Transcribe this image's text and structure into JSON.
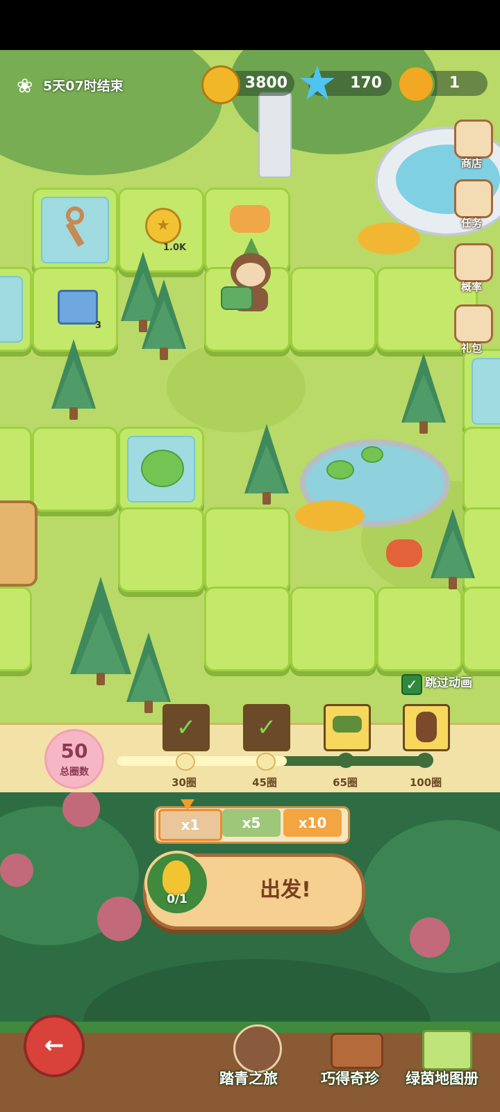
{
  "hud": {
    "timer": "5天07时结束",
    "coins": "3800",
    "gems": "170",
    "honey": "1"
  },
  "side_menu": [
    {
      "label": "商店",
      "icon": "shop-icon"
    },
    {
      "label": "任务",
      "icon": "task-icon"
    },
    {
      "label": "概率",
      "icon": "probability-icon"
    },
    {
      "label": "礼包",
      "icon": "gift-pack-icon"
    }
  ],
  "board": {
    "coin_tile_amount": "1.0K",
    "chest_count": "3",
    "skip_animation_label": "跳过动画",
    "skip_animation_checked": true
  },
  "progress": {
    "total_laps": "50",
    "total_laps_label": "总圈数",
    "fraction": 0.55,
    "milestones": [
      {
        "label": "30圈",
        "claimed": true
      },
      {
        "label": "45圈",
        "claimed": true
      },
      {
        "label": "65圈",
        "claimed": false
      },
      {
        "label": "100圈",
        "claimed": false
      }
    ]
  },
  "controls": {
    "multipliers": [
      "x1",
      "x5",
      "x10"
    ],
    "selected_multiplier": "x1",
    "tickets": "0/1",
    "go_label": "出发!"
  },
  "bottom_nav": [
    {
      "label": "踏青之旅",
      "icon": "monkey-icon"
    },
    {
      "label": "巧得奇珍",
      "icon": "treasure-suitcase-icon"
    },
    {
      "label": "绿茵地图册",
      "icon": "map-book-icon"
    }
  ]
}
